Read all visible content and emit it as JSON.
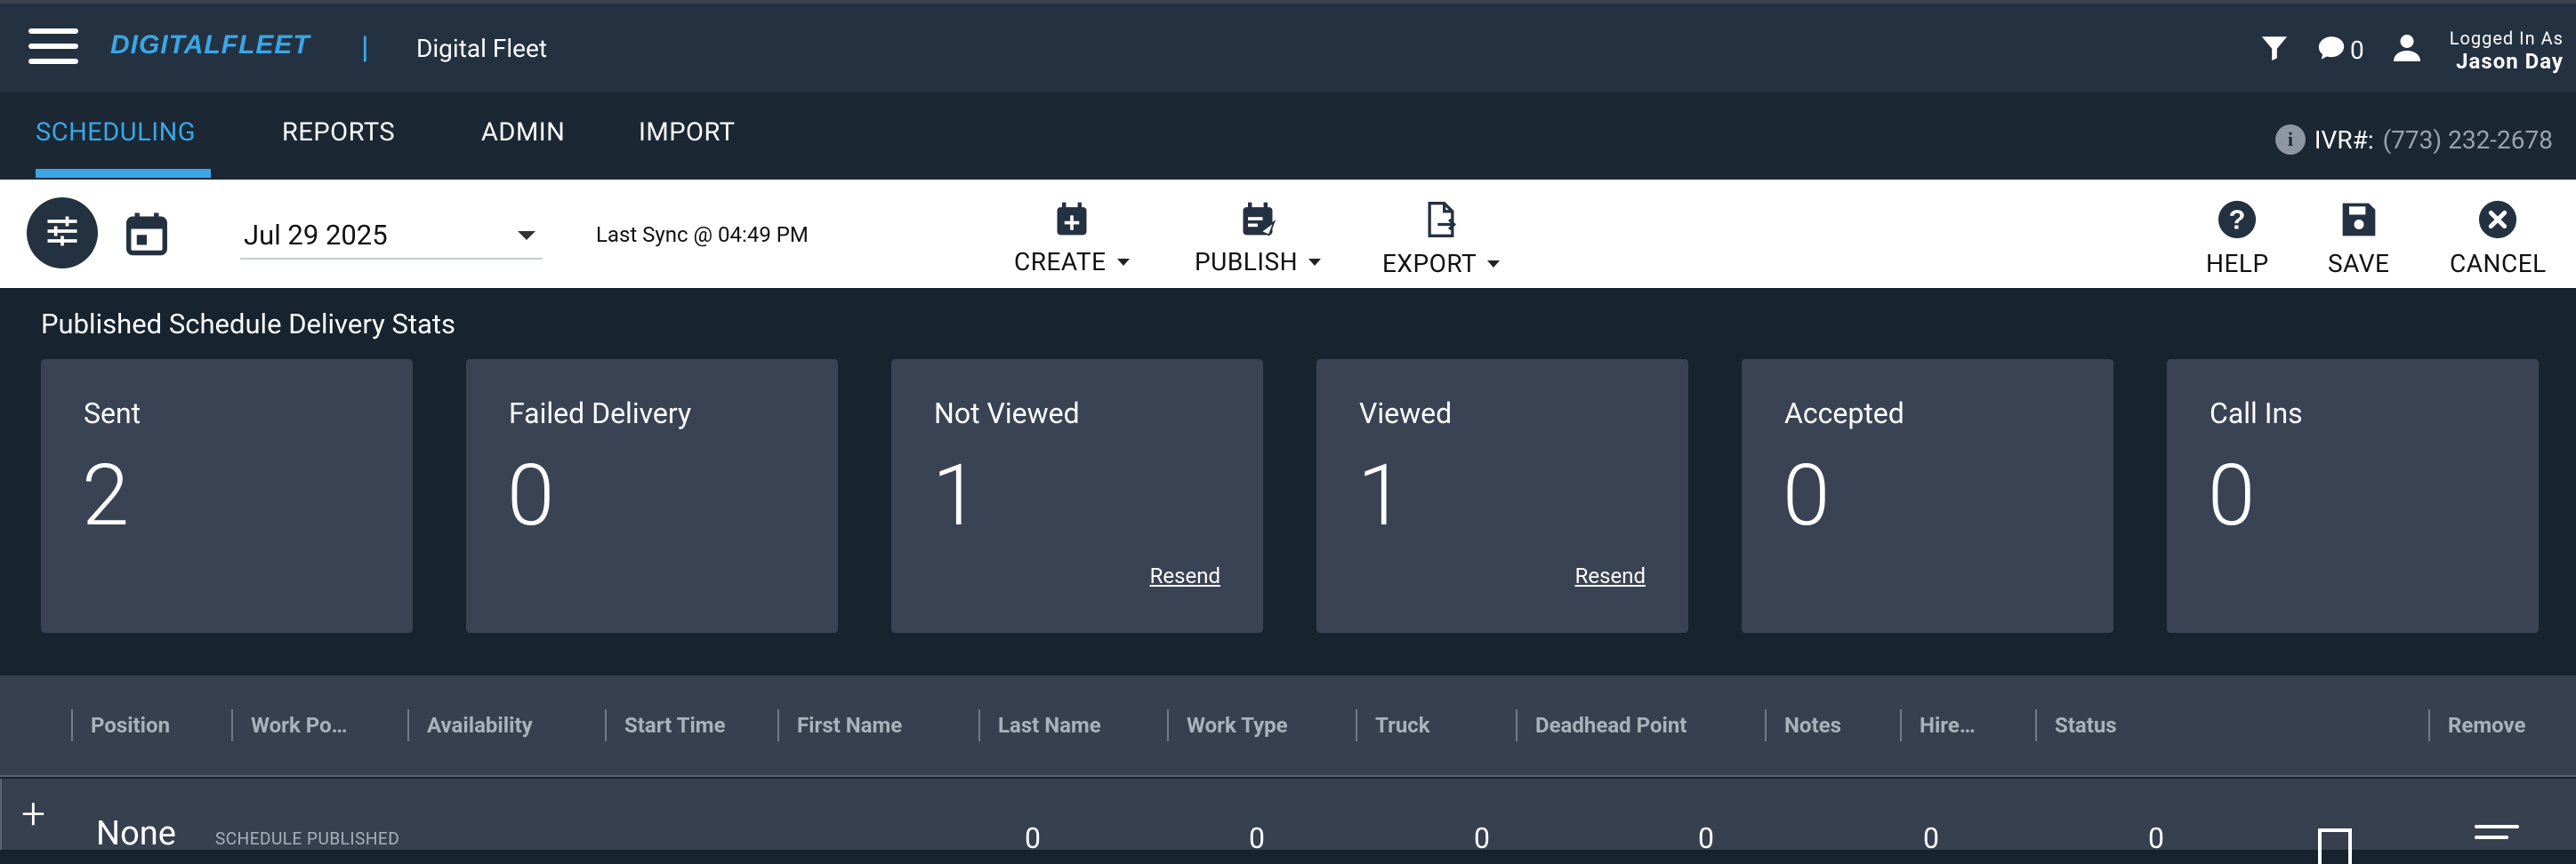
{
  "header": {
    "brand": "DIGITALFLEET",
    "brand_sep": "|",
    "app_title": "Digital Fleet",
    "message_count": "0",
    "logged_in_label": "Logged In As",
    "user_name": "Jason Day"
  },
  "nav": {
    "tabs": [
      {
        "label": "SCHEDULING",
        "active": true
      },
      {
        "label": "REPORTS",
        "active": false
      },
      {
        "label": "ADMIN",
        "active": false
      },
      {
        "label": "IMPORT",
        "active": false
      }
    ],
    "ivr_label": "IVR#:",
    "ivr_number": "(773) 232-2678"
  },
  "toolbar": {
    "date": "Jul 29 2025",
    "last_sync": "Last Sync @ 04:49 PM",
    "create_label": "CREATE",
    "publish_label": "PUBLISH",
    "export_label": "EXPORT",
    "help_label": "HELP",
    "save_label": "SAVE",
    "cancel_label": "CANCEL"
  },
  "stats": {
    "title": "Published Schedule Delivery Stats",
    "cards": [
      {
        "label": "Sent",
        "value": "2",
        "action": ""
      },
      {
        "label": "Failed Delivery",
        "value": "0",
        "action": ""
      },
      {
        "label": "Not Viewed",
        "value": "1",
        "action": "Resend"
      },
      {
        "label": "Viewed",
        "value": "1",
        "action": "Resend"
      },
      {
        "label": "Accepted",
        "value": "0",
        "action": ""
      },
      {
        "label": "Call Ins",
        "value": "0",
        "action": ""
      }
    ]
  },
  "grid": {
    "columns": [
      "Position",
      "Work Po…",
      "Availability",
      "Start Time",
      "First Name",
      "Last Name",
      "Work Type",
      "Truck",
      "Deadhead Point",
      "Notes",
      "Hire…",
      "Status",
      "Remove"
    ],
    "group_row": {
      "name": "None",
      "status": "SCHEDULE PUBLISHED",
      "counts": [
        "0",
        "0",
        "0",
        "0",
        "0",
        "0"
      ]
    }
  },
  "colors": {
    "accent": "#3aa6e6",
    "header_bg": "#243140",
    "card_bg": "#3a4354",
    "page_bg": "#17232e"
  }
}
